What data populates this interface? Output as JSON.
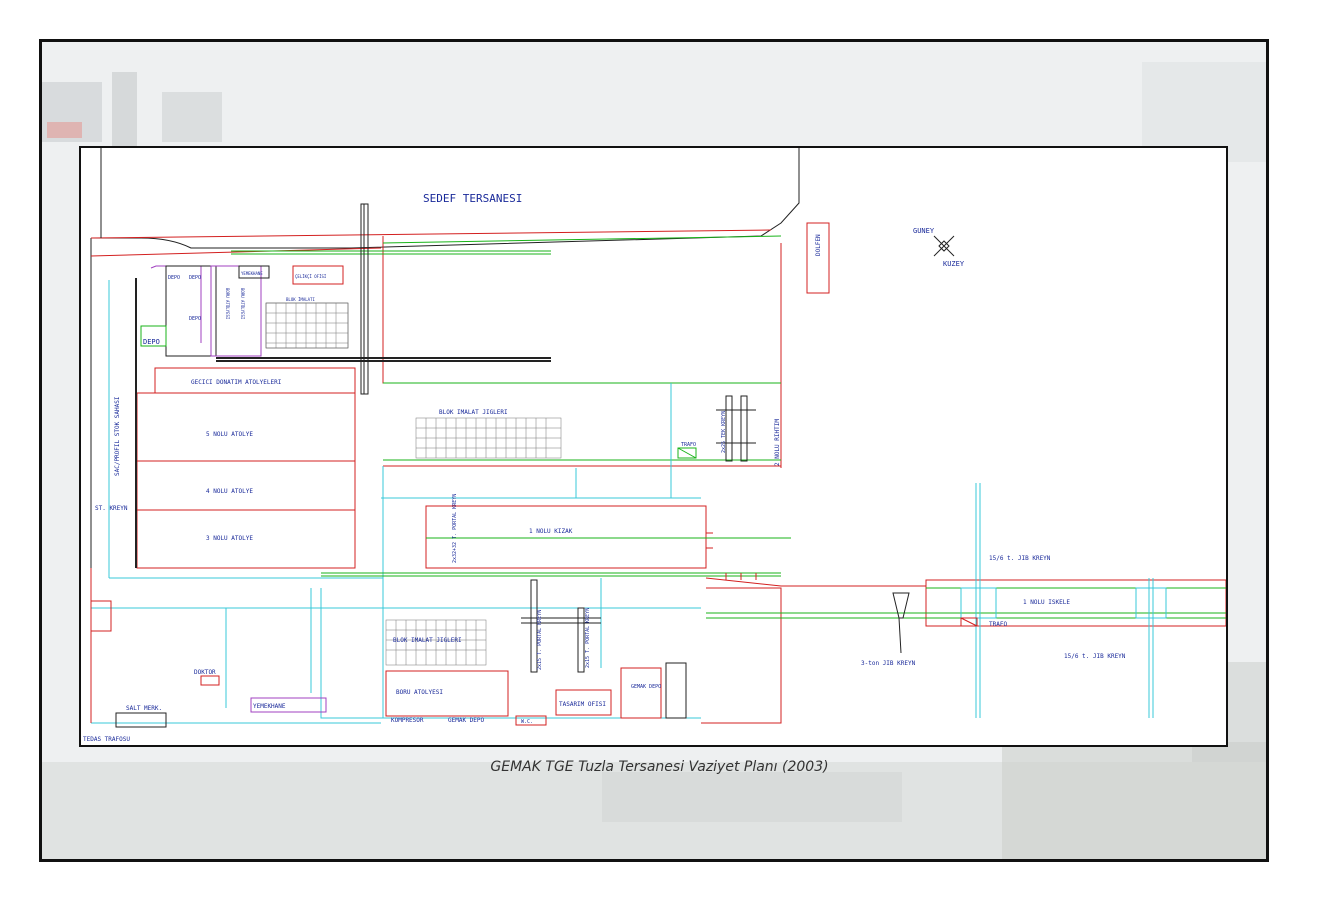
{
  "caption": "GEMAK TGE Tuzla Tersanesi Vaziyet Planı (2003)",
  "colors": {
    "red": "#d32020",
    "green": "#19b319",
    "cyan": "#38c8d8",
    "blue": "#1a2a9a",
    "purple": "#a040c0",
    "black": "#222222"
  },
  "labels": {
    "sedef": "SEDEF TERSANESI",
    "guney": "GUNEY",
    "kuzey": "KUZEY",
    "dolfen": "DOLFEN",
    "depo1": "DEPO",
    "depo2": "DEPO",
    "depo3": "DEPO",
    "depo_side": "DEPO",
    "yemekhane_top": "YEMEKHANE",
    "celik_ofisi": "ÇELİKÇİ OFİSİ",
    "boru_atolyesi_v": "BORU ATÖLYESİ",
    "boru_atolyesi_v2": "BORU ATÖLYESİ",
    "blok_small": "BLOK İMALATI",
    "gecici": "GECICI DONATIM ATOLYELERI",
    "nolu5": "5 NOLU ATOLYE",
    "nolu4": "4 NOLU ATOLYE",
    "nolu3": "3 NOLU ATOLYE",
    "sac_profil": "SAC/PROFIL STOK SAHASI",
    "st_kreyn": "ST. KREYN",
    "blok_imalat_top": "BLOK IMALAT JIGLERI",
    "trafo1": "TRAFO",
    "tek_kreyn": "2x25 TEK KREYN",
    "rihtim": "2 NOLU RIHTIM",
    "portal1": "2x32+32 T. PORTAL KREYN",
    "kizak": "1 NOLU KIZAK",
    "jib1": "15/6 t. JIB KREYN",
    "iskele": "1 NOLU ISKELE",
    "trafo2": "TRAFO",
    "jib2": "15/6 t. JIB KREYN",
    "jib3": "3-ton JIB KREYN",
    "portal2": "2x15 T. PORTAL KREYN",
    "portal3": "2x15 T. PORTAL KREYN",
    "blok_imalat_bottom": "BLOK IMALAT JIGLERI",
    "doktor": "DOKTOR",
    "boru_atolyesi": "BORU ATOLYESI",
    "tasarim": "TASARIM OFISI",
    "gemak_depo_box": "GEMAK DEPO",
    "salt": "SALT MERK.",
    "yemekhane": "YEMEKHANE",
    "kompresor": "KOMPRESOR",
    "gemak_depo": "GEMAK DEPO",
    "wc": "W.C.",
    "tedas": "TEDAS TRAFOSU"
  }
}
